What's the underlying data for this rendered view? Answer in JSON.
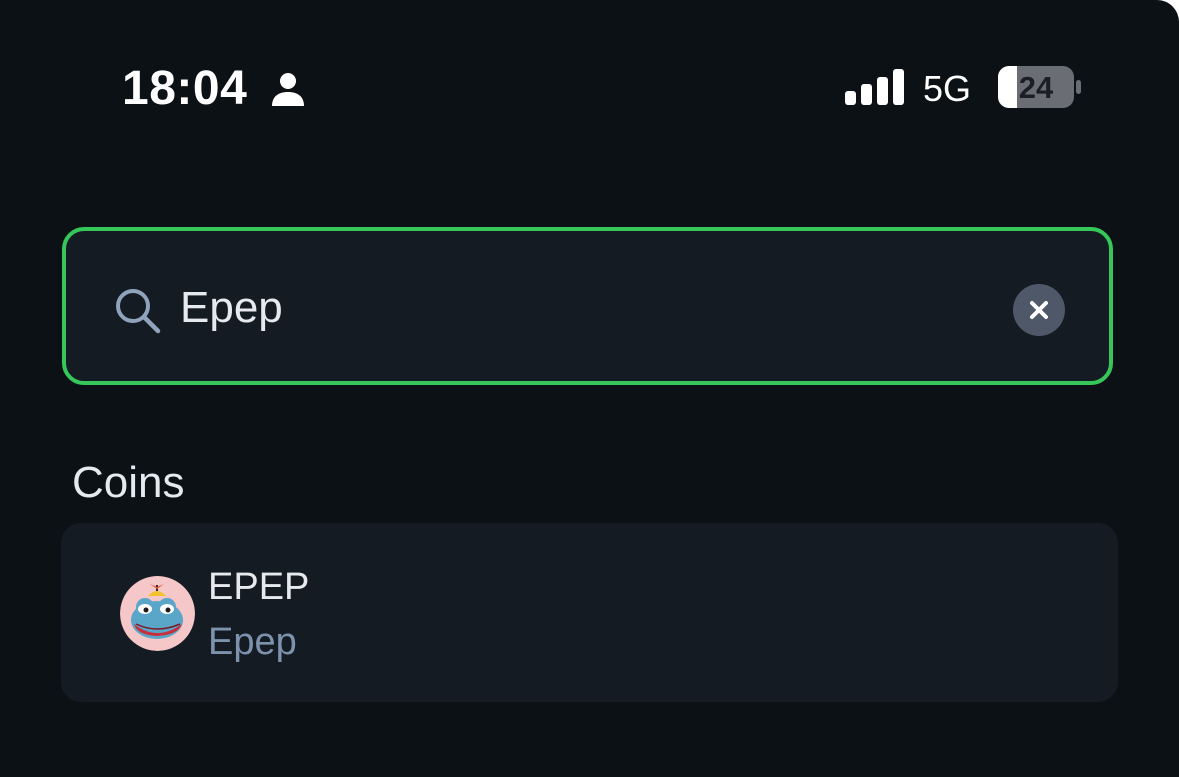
{
  "status_bar": {
    "time": "18:04",
    "network": "5G",
    "battery": "24",
    "icons": [
      "person-icon",
      "signal-icon",
      "battery-icon"
    ]
  },
  "search": {
    "value": "Epep",
    "icon": "search-icon",
    "clear_icon": "close-icon"
  },
  "sections": {
    "coins_title": "Coins"
  },
  "results": [
    {
      "symbol": "EPEP",
      "name": "Epep",
      "avatar_icon": "pepe-frog-avatar"
    }
  ],
  "colors": {
    "background": "#0c1116",
    "card": "#151b23",
    "accent_border": "#35c759",
    "primary_text": "#e6e9ee",
    "secondary_text": "#7d93ad",
    "clear_button": "#4f5869",
    "avatar_background": "#f6c7c9"
  }
}
